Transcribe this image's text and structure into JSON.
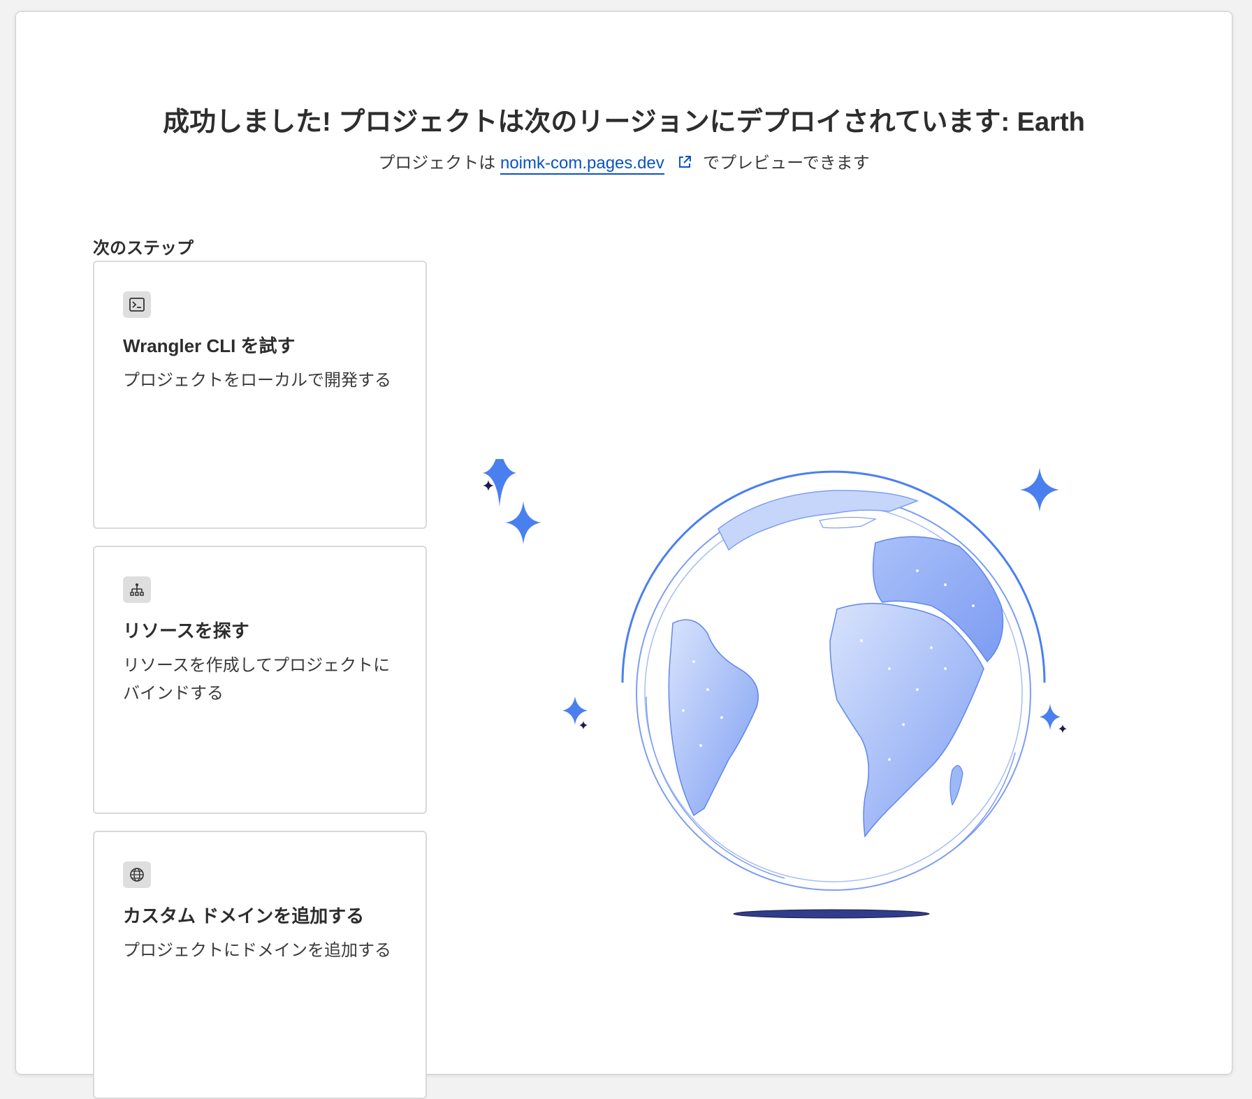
{
  "header": {
    "title": "成功しました! プロジェクトは次のリージョンにデプロイされています: Earth",
    "subtitle_prefix": "プロジェクトは",
    "preview_link": "noimk-com.pages.dev",
    "subtitle_suffix": "でプレビューできます"
  },
  "next_steps": {
    "heading": "次のステップ",
    "cards": [
      {
        "icon": "terminal-icon",
        "title": "Wrangler CLI を試す",
        "description": "プロジェクトをローカルで開発する"
      },
      {
        "icon": "sitemap-icon",
        "title": "リソースを探す",
        "description": "リソースを作成してプロジェクトにバインドする"
      },
      {
        "icon": "globe-icon",
        "title": "カスタム ドメインを追加する",
        "description": "プロジェクトにドメインを追加する"
      }
    ]
  },
  "colors": {
    "link": "#0b52c7",
    "accent_blue": "#4a7ff0",
    "globe_fill": "#9db8f7",
    "shadow": "#2f3d8a"
  }
}
